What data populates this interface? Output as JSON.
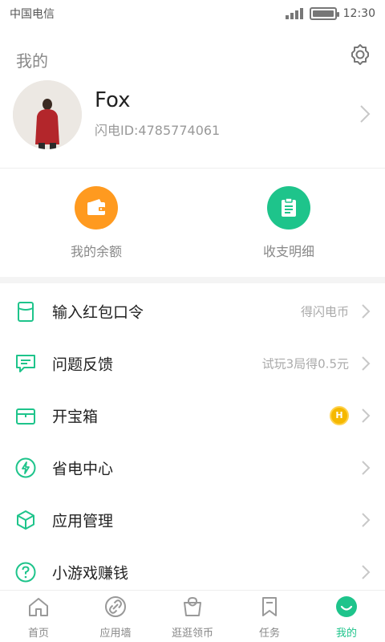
{
  "status_bar": {
    "carrier": "中国电信",
    "time": "12:30"
  },
  "header": {
    "title": "我的"
  },
  "profile": {
    "name": "Fox",
    "user_id": "闪电ID:4785774061"
  },
  "quick_actions": [
    {
      "label": "我的余额",
      "icon": "wallet-icon",
      "color": "#ff9a1f"
    },
    {
      "label": "收支明细",
      "icon": "clipboard-icon",
      "color": "#1ec48b"
    }
  ],
  "menu": [
    {
      "label": "输入红包口令",
      "hint": "得闪电币",
      "icon": "red-packet-icon"
    },
    {
      "label": "问题反馈",
      "hint": "试玩3局得0.5元",
      "icon": "feedback-icon"
    },
    {
      "label": "开宝箱",
      "hint": "",
      "badge": "H",
      "icon": "treasure-box-icon"
    },
    {
      "label": "省电中心",
      "hint": "",
      "icon": "lightning-icon"
    },
    {
      "label": "应用管理",
      "hint": "",
      "icon": "cube-icon"
    },
    {
      "label": "小游戏赚钱",
      "hint": "",
      "icon": "question-icon"
    }
  ],
  "tabs": [
    {
      "label": "首页",
      "icon": "home-icon"
    },
    {
      "label": "应用墙",
      "icon": "link-icon"
    },
    {
      "label": "逛逛领币",
      "icon": "shopping-bag-icon"
    },
    {
      "label": "任务",
      "icon": "bookmark-icon"
    },
    {
      "label": "我的",
      "icon": "smile-icon",
      "active": true
    }
  ],
  "colors": {
    "accent": "#1ec48b",
    "orange": "#ff9a1f",
    "text": "#222222",
    "muted": "#999999"
  }
}
